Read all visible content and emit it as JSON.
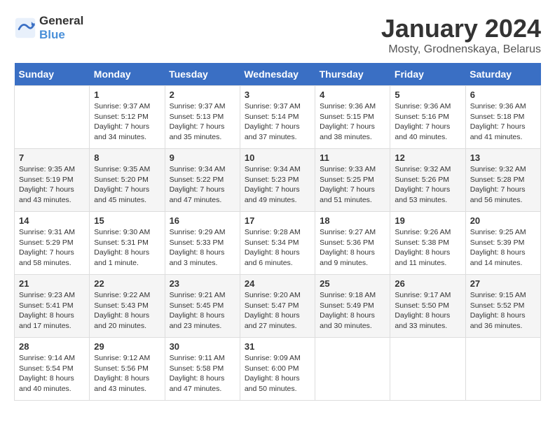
{
  "header": {
    "logo_line1": "General",
    "logo_line2": "Blue",
    "month_title": "January 2024",
    "location": "Mosty, Grodnenskaya, Belarus"
  },
  "weekdays": [
    "Sunday",
    "Monday",
    "Tuesday",
    "Wednesday",
    "Thursday",
    "Friday",
    "Saturday"
  ],
  "weeks": [
    [
      {
        "day": "",
        "sunrise": "",
        "sunset": "",
        "daylight": ""
      },
      {
        "day": "1",
        "sunrise": "Sunrise: 9:37 AM",
        "sunset": "Sunset: 5:12 PM",
        "daylight": "Daylight: 7 hours and 34 minutes."
      },
      {
        "day": "2",
        "sunrise": "Sunrise: 9:37 AM",
        "sunset": "Sunset: 5:13 PM",
        "daylight": "Daylight: 7 hours and 35 minutes."
      },
      {
        "day": "3",
        "sunrise": "Sunrise: 9:37 AM",
        "sunset": "Sunset: 5:14 PM",
        "daylight": "Daylight: 7 hours and 37 minutes."
      },
      {
        "day": "4",
        "sunrise": "Sunrise: 9:36 AM",
        "sunset": "Sunset: 5:15 PM",
        "daylight": "Daylight: 7 hours and 38 minutes."
      },
      {
        "day": "5",
        "sunrise": "Sunrise: 9:36 AM",
        "sunset": "Sunset: 5:16 PM",
        "daylight": "Daylight: 7 hours and 40 minutes."
      },
      {
        "day": "6",
        "sunrise": "Sunrise: 9:36 AM",
        "sunset": "Sunset: 5:18 PM",
        "daylight": "Daylight: 7 hours and 41 minutes."
      }
    ],
    [
      {
        "day": "7",
        "sunrise": "Sunrise: 9:35 AM",
        "sunset": "Sunset: 5:19 PM",
        "daylight": "Daylight: 7 hours and 43 minutes."
      },
      {
        "day": "8",
        "sunrise": "Sunrise: 9:35 AM",
        "sunset": "Sunset: 5:20 PM",
        "daylight": "Daylight: 7 hours and 45 minutes."
      },
      {
        "day": "9",
        "sunrise": "Sunrise: 9:34 AM",
        "sunset": "Sunset: 5:22 PM",
        "daylight": "Daylight: 7 hours and 47 minutes."
      },
      {
        "day": "10",
        "sunrise": "Sunrise: 9:34 AM",
        "sunset": "Sunset: 5:23 PM",
        "daylight": "Daylight: 7 hours and 49 minutes."
      },
      {
        "day": "11",
        "sunrise": "Sunrise: 9:33 AM",
        "sunset": "Sunset: 5:25 PM",
        "daylight": "Daylight: 7 hours and 51 minutes."
      },
      {
        "day": "12",
        "sunrise": "Sunrise: 9:32 AM",
        "sunset": "Sunset: 5:26 PM",
        "daylight": "Daylight: 7 hours and 53 minutes."
      },
      {
        "day": "13",
        "sunrise": "Sunrise: 9:32 AM",
        "sunset": "Sunset: 5:28 PM",
        "daylight": "Daylight: 7 hours and 56 minutes."
      }
    ],
    [
      {
        "day": "14",
        "sunrise": "Sunrise: 9:31 AM",
        "sunset": "Sunset: 5:29 PM",
        "daylight": "Daylight: 7 hours and 58 minutes."
      },
      {
        "day": "15",
        "sunrise": "Sunrise: 9:30 AM",
        "sunset": "Sunset: 5:31 PM",
        "daylight": "Daylight: 8 hours and 1 minute."
      },
      {
        "day": "16",
        "sunrise": "Sunrise: 9:29 AM",
        "sunset": "Sunset: 5:33 PM",
        "daylight": "Daylight: 8 hours and 3 minutes."
      },
      {
        "day": "17",
        "sunrise": "Sunrise: 9:28 AM",
        "sunset": "Sunset: 5:34 PM",
        "daylight": "Daylight: 8 hours and 6 minutes."
      },
      {
        "day": "18",
        "sunrise": "Sunrise: 9:27 AM",
        "sunset": "Sunset: 5:36 PM",
        "daylight": "Daylight: 8 hours and 9 minutes."
      },
      {
        "day": "19",
        "sunrise": "Sunrise: 9:26 AM",
        "sunset": "Sunset: 5:38 PM",
        "daylight": "Daylight: 8 hours and 11 minutes."
      },
      {
        "day": "20",
        "sunrise": "Sunrise: 9:25 AM",
        "sunset": "Sunset: 5:39 PM",
        "daylight": "Daylight: 8 hours and 14 minutes."
      }
    ],
    [
      {
        "day": "21",
        "sunrise": "Sunrise: 9:23 AM",
        "sunset": "Sunset: 5:41 PM",
        "daylight": "Daylight: 8 hours and 17 minutes."
      },
      {
        "day": "22",
        "sunrise": "Sunrise: 9:22 AM",
        "sunset": "Sunset: 5:43 PM",
        "daylight": "Daylight: 8 hours and 20 minutes."
      },
      {
        "day": "23",
        "sunrise": "Sunrise: 9:21 AM",
        "sunset": "Sunset: 5:45 PM",
        "daylight": "Daylight: 8 hours and 23 minutes."
      },
      {
        "day": "24",
        "sunrise": "Sunrise: 9:20 AM",
        "sunset": "Sunset: 5:47 PM",
        "daylight": "Daylight: 8 hours and 27 minutes."
      },
      {
        "day": "25",
        "sunrise": "Sunrise: 9:18 AM",
        "sunset": "Sunset: 5:49 PM",
        "daylight": "Daylight: 8 hours and 30 minutes."
      },
      {
        "day": "26",
        "sunrise": "Sunrise: 9:17 AM",
        "sunset": "Sunset: 5:50 PM",
        "daylight": "Daylight: 8 hours and 33 minutes."
      },
      {
        "day": "27",
        "sunrise": "Sunrise: 9:15 AM",
        "sunset": "Sunset: 5:52 PM",
        "daylight": "Daylight: 8 hours and 36 minutes."
      }
    ],
    [
      {
        "day": "28",
        "sunrise": "Sunrise: 9:14 AM",
        "sunset": "Sunset: 5:54 PM",
        "daylight": "Daylight: 8 hours and 40 minutes."
      },
      {
        "day": "29",
        "sunrise": "Sunrise: 9:12 AM",
        "sunset": "Sunset: 5:56 PM",
        "daylight": "Daylight: 8 hours and 43 minutes."
      },
      {
        "day": "30",
        "sunrise": "Sunrise: 9:11 AM",
        "sunset": "Sunset: 5:58 PM",
        "daylight": "Daylight: 8 hours and 47 minutes."
      },
      {
        "day": "31",
        "sunrise": "Sunrise: 9:09 AM",
        "sunset": "Sunset: 6:00 PM",
        "daylight": "Daylight: 8 hours and 50 minutes."
      },
      {
        "day": "",
        "sunrise": "",
        "sunset": "",
        "daylight": ""
      },
      {
        "day": "",
        "sunrise": "",
        "sunset": "",
        "daylight": ""
      },
      {
        "day": "",
        "sunrise": "",
        "sunset": "",
        "daylight": ""
      }
    ]
  ]
}
